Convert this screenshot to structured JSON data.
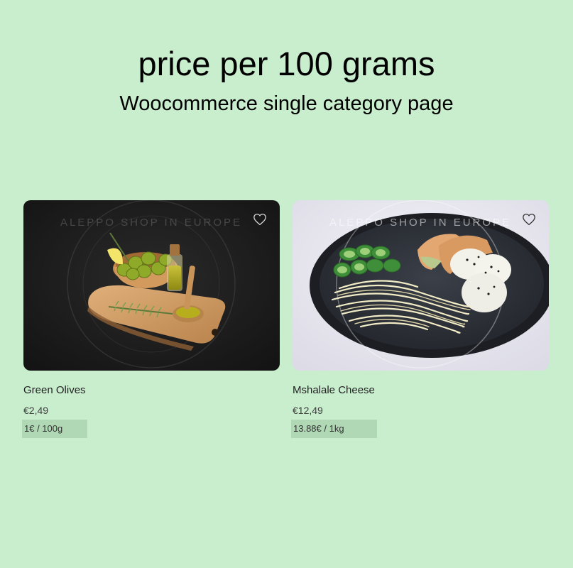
{
  "header": {
    "title": "price per 100 grams",
    "subtitle": "Woocommerce single category page"
  },
  "products": [
    {
      "name": "Green Olives",
      "price": "€2,49",
      "unit_price": "1€ / 100g",
      "image_watermark": "ALEPPO SHOP IN EUROPE",
      "wishlist_icon": "heart-outline-icon"
    },
    {
      "name": "Mshalale Cheese",
      "price": "€12,49",
      "unit_price": "13.88€ / 1kg",
      "image_watermark": "ALEPPO SHOP IN EUROPE",
      "wishlist_icon": "heart-outline-icon"
    }
  ],
  "colors": {
    "background": "#c8eecd",
    "unit_price_highlight": "#b0d8b5"
  }
}
